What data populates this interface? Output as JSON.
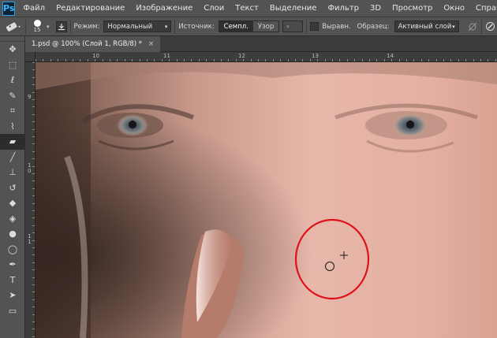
{
  "app": {
    "logo": "Ps"
  },
  "menu": [
    "Файл",
    "Редактирование",
    "Изображение",
    "Слои",
    "Текст",
    "Выделение",
    "Фильтр",
    "3D",
    "Просмотр",
    "Окно",
    "Справка"
  ],
  "options": {
    "brush_size": "15",
    "mode_label": "Режим:",
    "mode_value": "Нормальный",
    "source_label": "Источник:",
    "source_sampled": "Семпл.",
    "source_pattern": "Узор",
    "aligned_label": "Выравн.",
    "sample_label": "Образец:",
    "sample_value": "Активный слой"
  },
  "document": {
    "tab_title": "1.psd @ 100% (Слой 1, RGB/8) *",
    "close": "×"
  },
  "rulers": {
    "top": [
      "10",
      "11",
      "12",
      "13",
      "14"
    ],
    "left": [
      "9",
      "1\n0",
      "1\n1"
    ]
  },
  "colors": {
    "annotation": "#e0101a",
    "ui_dark": "#535353",
    "accent": "#2aa0e8"
  },
  "tools": [
    "move-icon",
    "marquee-icon",
    "lasso-icon",
    "quick-select-icon",
    "crop-icon",
    "eyedropper-icon",
    "healing-brush-icon",
    "brush-icon",
    "clone-stamp-icon",
    "history-brush-icon",
    "eraser-icon",
    "paint-bucket-icon",
    "blur-icon",
    "dodge-icon",
    "pen-icon",
    "type-icon",
    "path-select-icon",
    "rectangle-icon"
  ]
}
